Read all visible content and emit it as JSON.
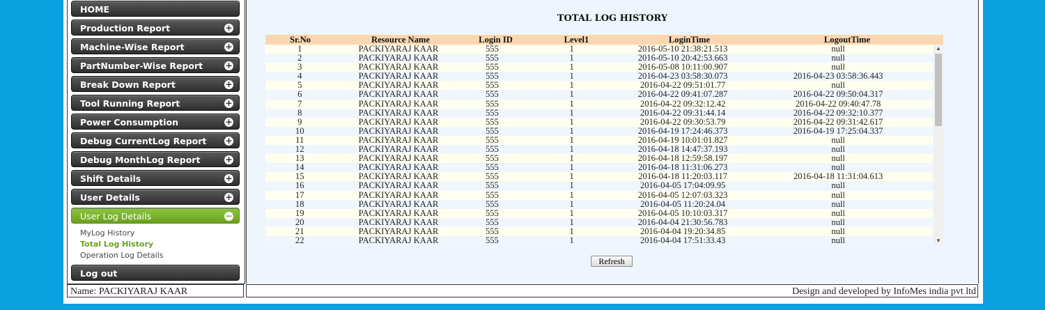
{
  "sidebar": {
    "items": [
      {
        "label": "HOME",
        "icon": ""
      },
      {
        "label": "Production Report",
        "icon": "plus-icon"
      },
      {
        "label": "Machine-Wise Report",
        "icon": "plus-icon"
      },
      {
        "label": "PartNumber-Wise Report",
        "icon": "plus-icon"
      },
      {
        "label": "Break Down Report",
        "icon": "plus-icon"
      },
      {
        "label": "Tool Running Report",
        "icon": "plus-icon"
      },
      {
        "label": "Power Consumption",
        "icon": "plus-icon"
      },
      {
        "label": "Debug CurrentLog Report",
        "icon": "plus-icon"
      },
      {
        "label": "Debug MonthLog Report",
        "icon": "plus-icon"
      },
      {
        "label": "Shift Details",
        "icon": "plus-icon"
      },
      {
        "label": "User Details",
        "icon": "plus-icon"
      },
      {
        "label": "User Log Details",
        "icon": "minus-icon"
      }
    ],
    "submenu": [
      "MyLog History",
      "Total Log History",
      "Operation Log Details"
    ],
    "logout_label": "Log out",
    "plus_glyph": "+",
    "minus_glyph": "−"
  },
  "main": {
    "title": "TOTAL LOG HISTORY",
    "columns": [
      "Sr.No",
      "Resource Name",
      "Login ID",
      "Level1",
      "LoginTime",
      "LogoutTime"
    ],
    "rows": [
      [
        "1",
        "PACKIYARAJ KAAR",
        "555",
        "1",
        "2016-05-10 21:38:21.513",
        "null"
      ],
      [
        "2",
        "PACKIYARAJ KAAR",
        "555",
        "1",
        "2016-05-10 20:42:53.663",
        "null"
      ],
      [
        "3",
        "PACKIYARAJ KAAR",
        "555",
        "1",
        "2016-05-08 10:11:00.907",
        "null"
      ],
      [
        "4",
        "PACKIYARAJ KAAR",
        "555",
        "1",
        "2016-04-23 03:58:30.073",
        "2016-04-23 03:58:36.443"
      ],
      [
        "5",
        "PACKIYARAJ KAAR",
        "555",
        "1",
        "2016-04-22 09:51:01.77",
        "null"
      ],
      [
        "6",
        "PACKIYARAJ KAAR",
        "555",
        "1",
        "2016-04-22 09:41:07.287",
        "2016-04-22 09:50:04.317"
      ],
      [
        "7",
        "PACKIYARAJ KAAR",
        "555",
        "1",
        "2016-04-22 09:32:12.42",
        "2016-04-22 09:40:47.78"
      ],
      [
        "8",
        "PACKIYARAJ KAAR",
        "555",
        "1",
        "2016-04-22 09:31:44.14",
        "2016-04-22 09:32:10.377"
      ],
      [
        "9",
        "PACKIYARAJ KAAR",
        "555",
        "1",
        "2016-04-22 09:30:53.79",
        "2016-04-22 09:31:42.617"
      ],
      [
        "10",
        "PACKIYARAJ KAAR",
        "555",
        "1",
        "2016-04-19 17:24:46.373",
        "2016-04-19 17:25:04.337"
      ],
      [
        "11",
        "PACKIYARAJ KAAR",
        "555",
        "1",
        "2016-04-19 10:01:01.827",
        "null"
      ],
      [
        "12",
        "PACKIYARAJ KAAR",
        "555",
        "1",
        "2016-04-18 14:47:37.193",
        "null"
      ],
      [
        "13",
        "PACKIYARAJ KAAR",
        "555",
        "1",
        "2016-04-18 12:59:58.197",
        "null"
      ],
      [
        "14",
        "PACKIYARAJ KAAR",
        "555",
        "1",
        "2016-04-18 11:31:06.273",
        "null"
      ],
      [
        "15",
        "PACKIYARAJ KAAR",
        "555",
        "1",
        "2016-04-18 11:20:03.117",
        "2016-04-18 11:31:04.613"
      ],
      [
        "16",
        "PACKIYARAJ KAAR",
        "555",
        "1",
        "2016-04-05 17:04:09.95",
        "null"
      ],
      [
        "17",
        "PACKIYARAJ KAAR",
        "555",
        "1",
        "2016-04-05 12:07:03.323",
        "null"
      ],
      [
        "18",
        "PACKIYARAJ KAAR",
        "555",
        "1",
        "2016-04-05 11:20:24.04",
        "null"
      ],
      [
        "19",
        "PACKIYARAJ KAAR",
        "555",
        "1",
        "2016-04-05 10:10:03.317",
        "null"
      ],
      [
        "20",
        "PACKIYARAJ KAAR",
        "555",
        "1",
        "2016-04-04 21:30:56.783",
        "null"
      ],
      [
        "21",
        "PACKIYARAJ KAAR",
        "555",
        "1",
        "2016-04-04 19:20:34.85",
        "null"
      ],
      [
        "22",
        "PACKIYARAJ KAAR",
        "555",
        "1",
        "2016-04-04 17:51:33.43",
        "null"
      ]
    ],
    "refresh_label": "Refresh",
    "scroll_up_glyph": "▲",
    "scroll_down_glyph": "▼"
  },
  "footer": {
    "user": "Name: PACKIYARAJ KAAR",
    "credit": "Design and developed by InfoMes india pvt ltd"
  },
  "colors": {
    "background": "#0ba0e0",
    "menu_dark": "#3a3a3a",
    "menu_active": "#7ab52e",
    "table_header": "#fad7b0"
  }
}
